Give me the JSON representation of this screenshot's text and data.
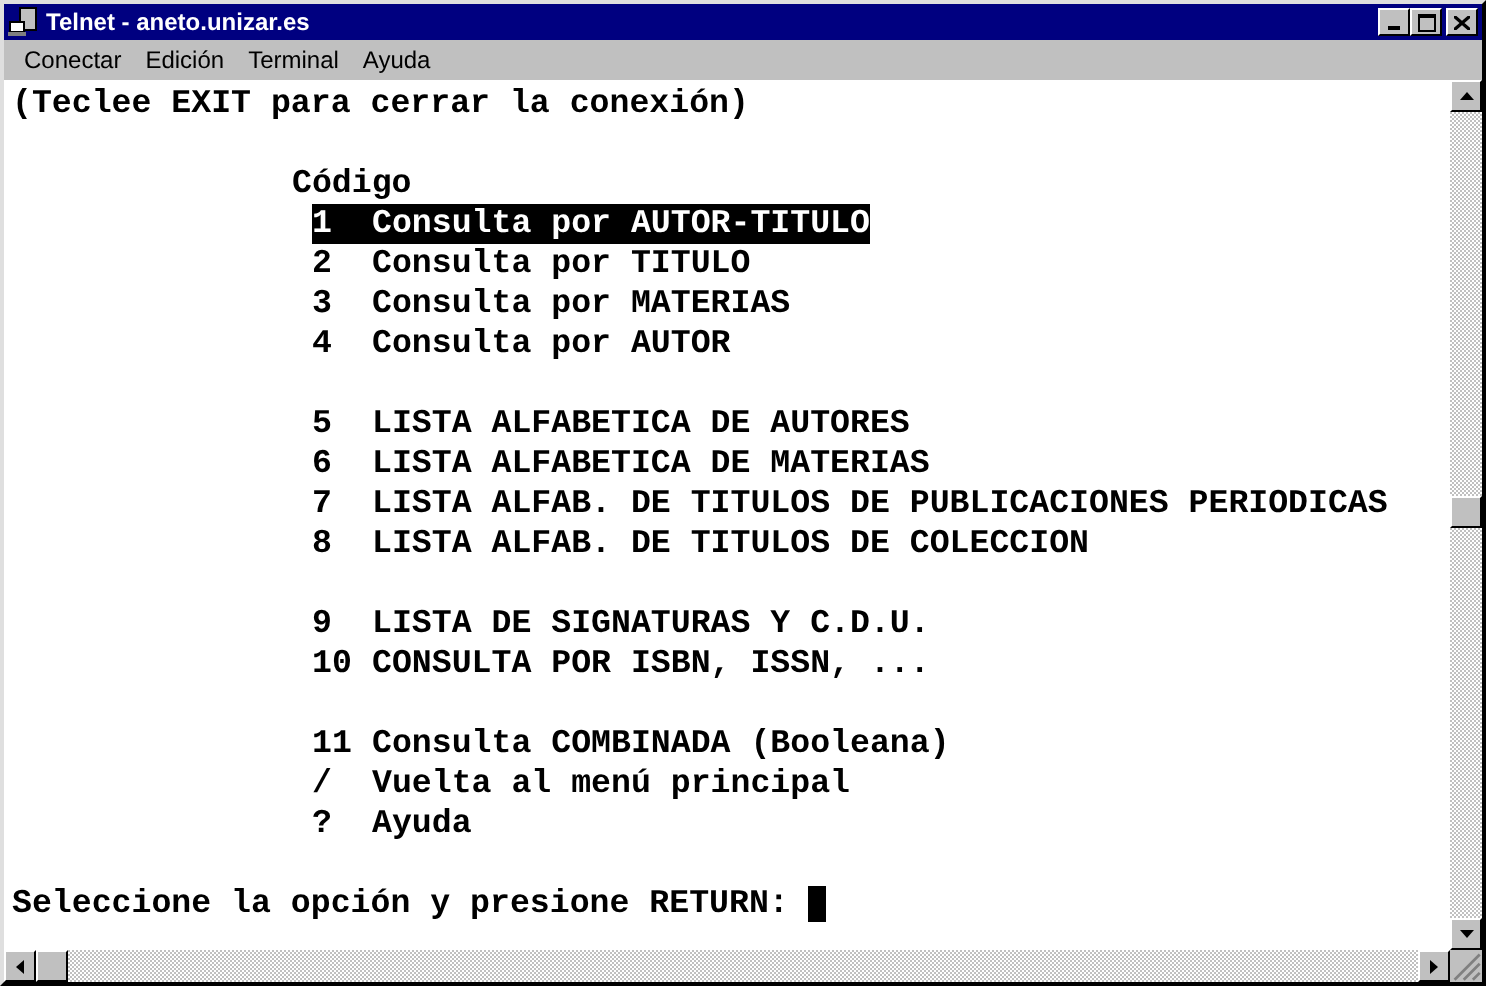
{
  "window": {
    "title": "Telnet - aneto.unizar.es"
  },
  "menu": [
    "Conectar",
    "Edición",
    "Terminal",
    "Ayuda"
  ],
  "terminal": {
    "header": "(Teclee EXIT para cerrar la conexión)",
    "menu_title": "Código",
    "option_groups": [
      [
        {
          "number": "1",
          "label": "Consulta por AUTOR-TITULO",
          "selected": true
        },
        {
          "number": "2",
          "label": "Consulta por TITULO",
          "selected": false
        },
        {
          "number": "3",
          "label": "Consulta por MATERIAS",
          "selected": false
        },
        {
          "number": "4",
          "label": "Consulta por AUTOR",
          "selected": false
        }
      ],
      [
        {
          "number": "5",
          "label": "LISTA ALFABETICA DE AUTORES",
          "selected": false
        },
        {
          "number": "6",
          "label": "LISTA ALFABETICA DE MATERIAS",
          "selected": false
        },
        {
          "number": "7",
          "label": "LISTA ALFAB. DE TITULOS DE PUBLICACIONES PERIODICAS",
          "selected": false
        },
        {
          "number": "8",
          "label": "LISTA ALFAB. DE TITULOS DE COLECCION",
          "selected": false
        }
      ],
      [
        {
          "number": "9",
          "label": "LISTA DE SIGNATURAS Y C.D.U.",
          "selected": false
        },
        {
          "number": "10",
          "label": "CONSULTA POR ISBN, ISSN, ...",
          "selected": false
        }
      ],
      [
        {
          "number": "11",
          "label": "Consulta COMBINADA (Booleana)",
          "selected": false
        },
        {
          "number": "/",
          "label": "Vuelta al menú principal",
          "selected": false
        },
        {
          "number": "?",
          "label": "Ayuda",
          "selected": false
        }
      ]
    ],
    "prompt": "Seleccione la opción y presione RETURN:"
  }
}
